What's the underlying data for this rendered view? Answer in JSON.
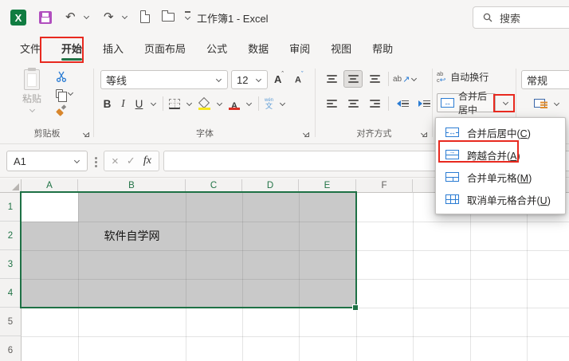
{
  "titlebar": {
    "title": "工作簿1 - Excel",
    "search_placeholder": "搜索"
  },
  "tabs": {
    "items": [
      {
        "label": "文件"
      },
      {
        "label": "开始",
        "active": true
      },
      {
        "label": "插入"
      },
      {
        "label": "页面布局"
      },
      {
        "label": "公式"
      },
      {
        "label": "数据"
      },
      {
        "label": "审阅"
      },
      {
        "label": "视图"
      },
      {
        "label": "帮助"
      }
    ]
  },
  "ribbon": {
    "clipboard": {
      "paste_label": "粘贴",
      "group_label": "剪贴板"
    },
    "font": {
      "font_name": "等线",
      "font_size": "12",
      "bold": "B",
      "italic": "I",
      "underline": "U",
      "phonetic_top": "wén",
      "phonetic_bottom": "文",
      "group_label": "字体"
    },
    "alignment": {
      "wrap_label": "自动换行",
      "merge_label": "合并后居中",
      "orientation_text": "ab",
      "wrap_icon_top": "ab",
      "wrap_icon_bottom": "c",
      "group_label": "对齐方式"
    },
    "number": {
      "format_value": "常规"
    }
  },
  "formula_bar": {
    "cell_ref": "A1",
    "cancel_glyph": "×",
    "enter_glyph": "✓",
    "fx_label": "fx"
  },
  "merge_menu": {
    "items": [
      {
        "pre": "合并后居中(",
        "key": "C",
        "post": ")"
      },
      {
        "pre": "跨越合并(",
        "key": "A",
        "post": ")",
        "annotated": true
      },
      {
        "pre": "合并单元格(",
        "key": "M",
        "post": ")"
      },
      {
        "pre": "取消单元格合并(",
        "key": "U",
        "post": ")"
      }
    ]
  },
  "sheet": {
    "columns": [
      "A",
      "B",
      "C",
      "D",
      "E",
      "F"
    ],
    "rows": [
      "1",
      "2",
      "3",
      "4",
      "5",
      "6"
    ],
    "cell_b2_text": "软件自学网",
    "active_cell": "A1",
    "selection_range": "A1:E4"
  },
  "glyphs": {
    "undo": "↶",
    "redo": "↷",
    "left_right_arrow": "↔",
    "right_arrow": "→",
    "ne_arrow": "↗",
    "return_arrow": "↩",
    "font_a": "A",
    "caret_up": "ˆ",
    "caret_down": "ˇ"
  },
  "colors": {
    "excel_green": "#217346",
    "annotation_red": "#e8291f",
    "icon_blue": "#2b7cd3",
    "selection_fill": "#c9c9c9"
  }
}
